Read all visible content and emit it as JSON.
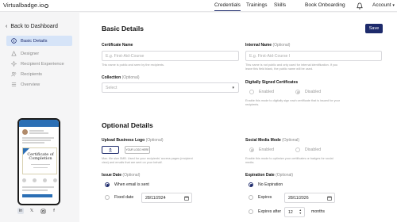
{
  "brand": {
    "name": "Virtualbadge.io"
  },
  "topnav": {
    "tabs": [
      {
        "label": "Credentials"
      },
      {
        "label": "Trainings"
      },
      {
        "label": "Skills"
      },
      {
        "label": "Book Onboarding"
      }
    ],
    "account_label": "Account"
  },
  "sidebar": {
    "back_label": "Back to Dashboard",
    "items": [
      {
        "label": "Basic Details",
        "icon": "info-icon"
      },
      {
        "label": "Designer",
        "icon": "palette-icon"
      },
      {
        "label": "Recipient Experience",
        "icon": "sparkle-icon"
      },
      {
        "label": "Recipients",
        "icon": "users-icon"
      },
      {
        "label": "Overview",
        "icon": "list-icon"
      }
    ]
  },
  "preview": {
    "cert_title_line1": "Certificate of",
    "cert_title_line2": "Completion"
  },
  "basic": {
    "title": "Basic Details",
    "save_label": "Save",
    "cert_name": {
      "label": "Certificate Name",
      "placeholder": "E.g. First-Aid-Course",
      "hint": "This name is public and seen by the recipients."
    },
    "internal_name": {
      "label": "Internal Name",
      "optional": "(Optional)",
      "placeholder": "E.g. First-Aid-Course I",
      "hint": "This name is not public and only used for internal identification. If you leave this field blank, the public name will be used."
    },
    "collection": {
      "label": "Collection",
      "optional": "(Optional)",
      "placeholder": "Select"
    },
    "digital_sign": {
      "label": "Digitally Signed Certificates",
      "enabled": "Enabled",
      "disabled": "Disabled",
      "hint": "Enable this mode to digitally sign each certificate that is issued for your recipients."
    }
  },
  "optional": {
    "title": "Optional Details",
    "logo": {
      "label": "Upload Business Logo",
      "optional": "(Optional)",
      "button_label": "YOUR LOGO HERE",
      "hint": "Max. file size 5MB. Used for your recipients' access pages (recipient view) and emails that are sent on your behalf."
    },
    "social": {
      "label": "Social Media Mode",
      "optional": "(Optional)",
      "enabled": "Enabled",
      "disabled": "Disabled",
      "hint": "Enable this mode to optimize your certificates or badges for social media."
    },
    "issue_date": {
      "label": "Issue Date",
      "optional": "(Optional)",
      "when_sent": "When email is sent",
      "fixed_date": "Fixed date",
      "date_value": "28/11/2024"
    },
    "expiration": {
      "label": "Expiration Date",
      "optional": "(Optional)",
      "no_expiration": "No Expiration",
      "expires": "Expires",
      "expires_date": "28/11/2026",
      "expires_after": "Expires after",
      "after_value": "12",
      "after_unit": "months"
    }
  }
}
